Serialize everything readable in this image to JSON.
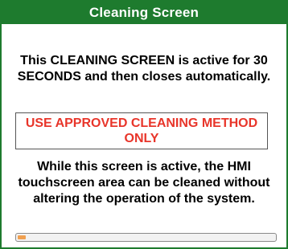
{
  "window": {
    "title": "Cleaning Screen"
  },
  "intro_text": "This CLEANING SCREEN is active for 30 SECONDS and then closes automatically.",
  "warning_text": "USE APPROVED CLEANING METHOD ONLY",
  "info_text": "While this screen is active, the HMI touchscreen area can be cleaned without altering the operation of the system.",
  "progress": {
    "fraction": 0.03
  },
  "colors": {
    "title_bar": "#1e7b2e",
    "warning_text": "#e8352a",
    "progress_fill": "#f0a050"
  }
}
